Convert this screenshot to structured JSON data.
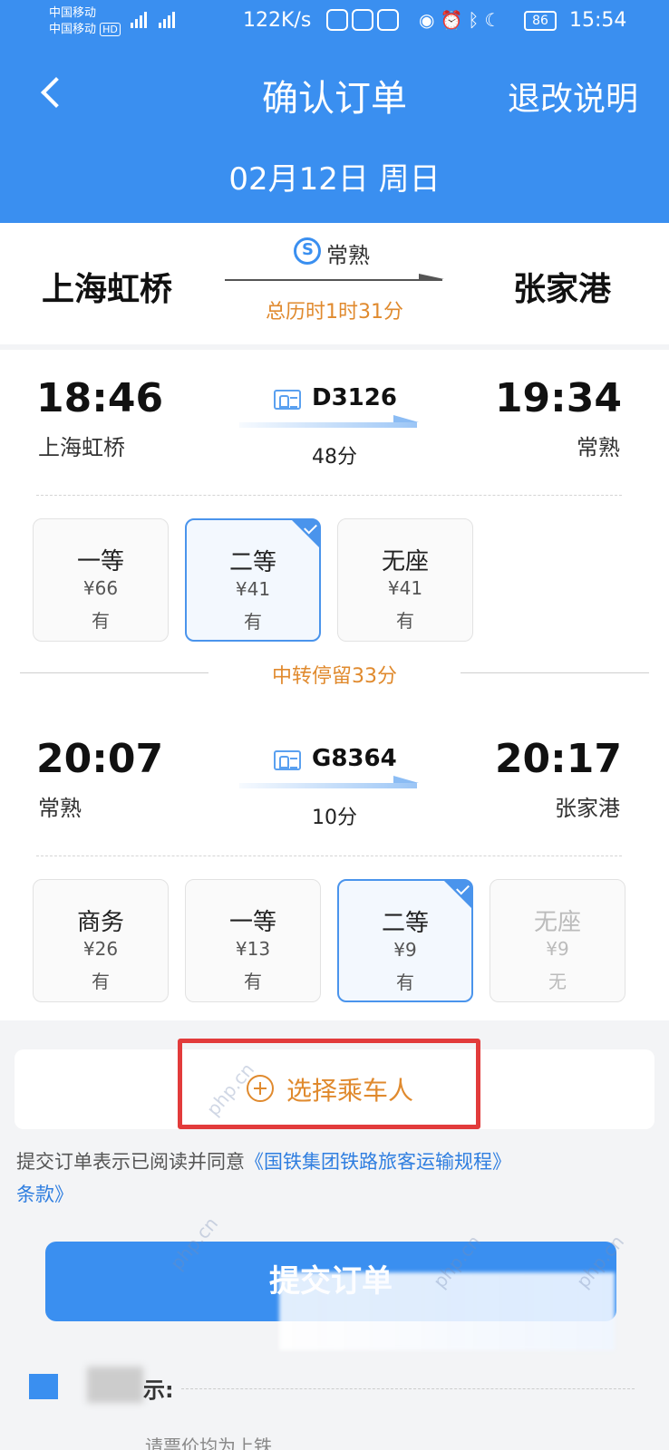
{
  "status_bar": {
    "carrier_1": "中国移动",
    "carrier_2": "中国移动",
    "hd": "HD",
    "net_speed": "122K/s",
    "battery": "86",
    "time": "15:54"
  },
  "header": {
    "title": "确认订单",
    "refund_link": "退改说明",
    "date": "02月12日 周日"
  },
  "summary": {
    "from": "上海虹桥",
    "to": "张家港",
    "transfer_station": "常熟",
    "total_duration": "总历时1时31分"
  },
  "segments": [
    {
      "dep_time": "18:46",
      "dep_station": "上海虹桥",
      "arr_time": "19:34",
      "arr_station": "常熟",
      "train_no": "D3126",
      "duration": "48分",
      "seats": [
        {
          "class": "一等",
          "price": "¥66",
          "avail": "有",
          "selected": false
        },
        {
          "class": "二等",
          "price": "¥41",
          "avail": "有",
          "selected": true
        },
        {
          "class": "无座",
          "price": "¥41",
          "avail": "有",
          "selected": false
        }
      ]
    },
    {
      "dep_time": "20:07",
      "dep_station": "常熟",
      "arr_time": "20:17",
      "arr_station": "张家港",
      "train_no": "G8364",
      "duration": "10分",
      "seats": [
        {
          "class": "商务",
          "price": "¥26",
          "avail": "有",
          "selected": false
        },
        {
          "class": "一等",
          "price": "¥13",
          "avail": "有",
          "selected": false
        },
        {
          "class": "二等",
          "price": "¥9",
          "avail": "有",
          "selected": true
        },
        {
          "class": "无座",
          "price": "¥9",
          "avail": "无",
          "selected": false,
          "disabled": true
        }
      ]
    }
  ],
  "stopover": "中转停留33分",
  "passenger": {
    "label": "选择乘车人"
  },
  "agreement": {
    "prefix": "提交订单表示已阅读并同意",
    "link_part1": "《国铁集团铁路旅客运输规程》",
    "link_part2": "条款》"
  },
  "submit": {
    "label": "提交订单"
  },
  "tips": {
    "title": "示:",
    "text": "请票价均为上铁"
  },
  "watermark": "php.cn",
  "colors": {
    "primary": "#3a8ff0",
    "accent_orange": "#e08a2e",
    "highlight_red": "#e23b3b"
  }
}
